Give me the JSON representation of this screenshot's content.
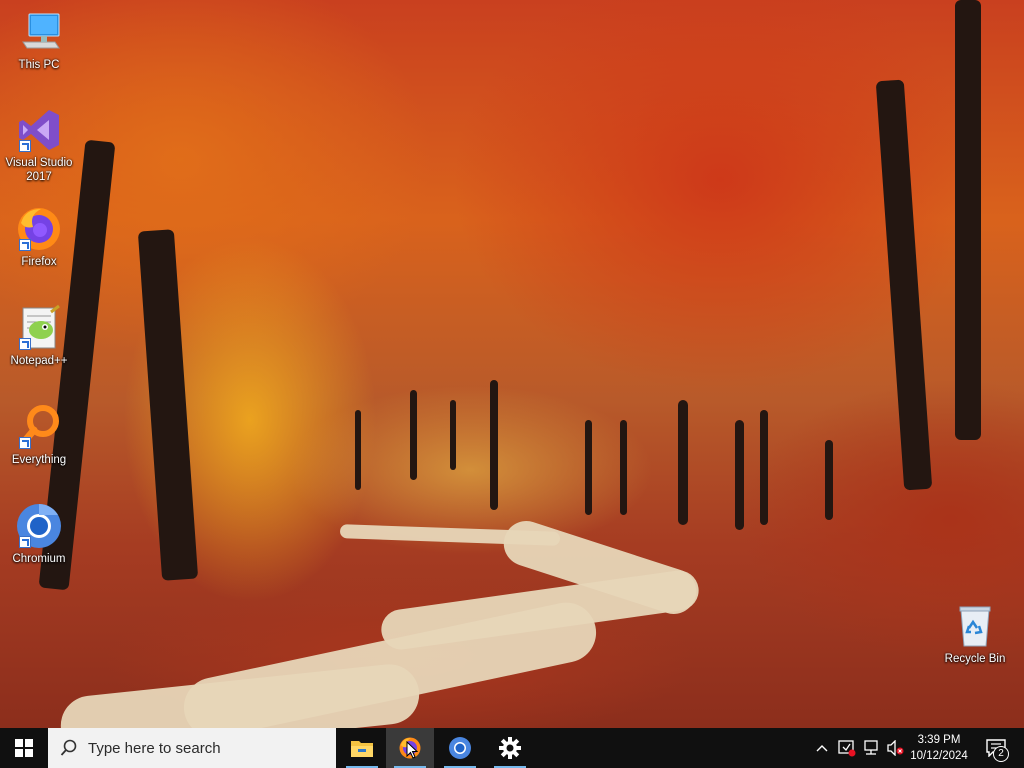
{
  "desktop": {
    "icons": [
      {
        "label": "This PC",
        "icon": "computer-icon"
      },
      {
        "label": "Visual Studio 2017",
        "icon": "visual-studio-icon"
      },
      {
        "label": "Firefox",
        "icon": "firefox-icon"
      },
      {
        "label": "Notepad++",
        "icon": "notepadpp-icon"
      },
      {
        "label": "Everything",
        "icon": "search-magnifier-icon"
      },
      {
        "label": "Chromium",
        "icon": "chromium-icon"
      },
      {
        "label": "Recycle Bin",
        "icon": "recycle-bin-icon"
      }
    ]
  },
  "taskbar": {
    "search_placeholder": "Type here to search",
    "apps": [
      {
        "name": "File Explorer",
        "icon": "folder-icon"
      },
      {
        "name": "Firefox",
        "icon": "firefox-icon"
      },
      {
        "name": "Chromium",
        "icon": "chromium-icon"
      },
      {
        "name": "Settings",
        "icon": "gear-icon"
      }
    ],
    "clock": {
      "time": "3:39 PM",
      "date": "10/12/2024"
    },
    "notification_count": "2"
  },
  "colors": {
    "taskbar_bg": "#101010",
    "accent": "#76b9ed"
  }
}
